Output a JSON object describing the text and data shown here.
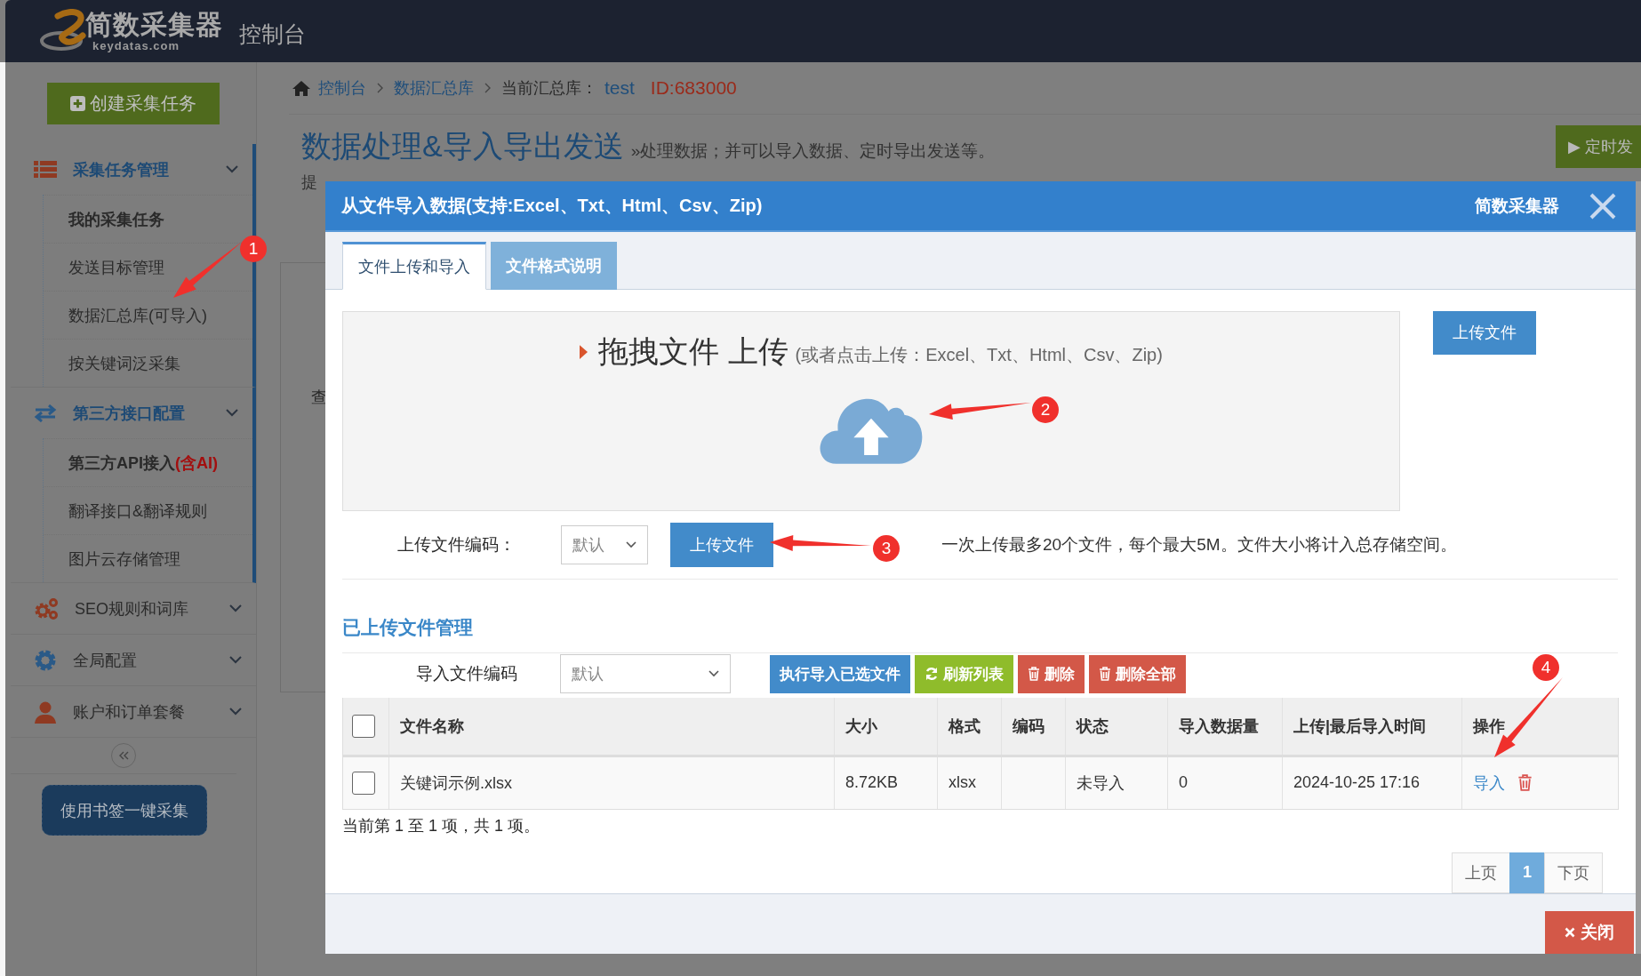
{
  "header": {
    "logo_text": "简数采集器",
    "logo_domain": "keydatas.com",
    "title": "控制台"
  },
  "sidebar": {
    "create_button": "创建采集任务",
    "groups": [
      {
        "label": "采集任务管理",
        "kind": "list",
        "expanded": true,
        "children": [
          {
            "label": "我的采集任务",
            "bold": true
          },
          {
            "label": "发送目标管理",
            "bold": false
          },
          {
            "label": "数据汇总库(可导入)",
            "bold": false
          },
          {
            "label": "按关键词泛采集",
            "bold": false
          }
        ]
      },
      {
        "label": "第三方接口配置",
        "kind": "swap",
        "expanded": true,
        "children": [
          {
            "label": "第三方API接入",
            "tag": "(含AI)",
            "bold": true
          },
          {
            "label": "翻译接口&翻译规则",
            "bold": false
          },
          {
            "label": "图片云存储管理",
            "bold": false
          }
        ]
      },
      {
        "label": "SEO规则和词库",
        "kind": "gears",
        "expanded": false
      },
      {
        "label": "全局配置",
        "kind": "gear",
        "expanded": false
      },
      {
        "label": "账户和订单套餐",
        "kind": "user",
        "expanded": false
      }
    ],
    "bookmark_button": "使用书签一键采集"
  },
  "breadcrumb": {
    "items": [
      "控制台",
      "数据汇总库"
    ],
    "current_label": "当前汇总库：",
    "current_name": "test",
    "current_id": "ID:683000"
  },
  "page": {
    "title": "数据处理&导入导出发送",
    "subtitle": "»处理数据；并可以导入数据、定时导出发送等。",
    "hint": "提",
    "side_text": "查",
    "schedule_button": "▶ 定时发"
  },
  "dialog": {
    "title": "从文件导入数据(支持:Excel、Txt、Html、Csv、Zip)",
    "brand": "简数采集器",
    "tabs": [
      {
        "label": "文件上传和导入",
        "selected": true
      },
      {
        "label": "文件格式说明",
        "selected": false
      }
    ],
    "dropzone": {
      "title": "拖拽文件 上传",
      "hint": "(或者点击上传：Excel、Txt、Html、Csv、Zip)"
    },
    "upload_button": "上传文件",
    "encoding": {
      "label": "上传文件编码：",
      "value": "默认",
      "button": "上传文件",
      "note": "一次上传最多20个文件，每个最大5M。文件大小将计入总存储空间。"
    },
    "files": {
      "title": "已上传文件管理",
      "encoding_label": "导入文件编码",
      "encoding_value": "默认",
      "actions": [
        {
          "label": "执行导入已选文件",
          "kind": "primary"
        },
        {
          "label": "刷新列表",
          "kind": "refresh"
        },
        {
          "label": "删除",
          "kind": "delete"
        },
        {
          "label": "删除全部",
          "kind": "delete"
        }
      ]
    },
    "table": {
      "select_all_checked": false,
      "columns": [
        "文件名称",
        "大小",
        "格式",
        "编码",
        "状态",
        "导入数据量",
        "上传|最后导入时间",
        "操作"
      ],
      "rows": [
        {
          "checked": false,
          "name": "关键词示例.xlsx",
          "size": "8.72KB",
          "format": "xlsx",
          "status": "未导入",
          "count": "0",
          "time": "2024-10-25 17:16",
          "action": "导入"
        }
      ]
    },
    "summary": "当前第 1 至 1 项，共 1 项。",
    "pagination": [
      {
        "label": "上页",
        "selected": false
      },
      {
        "label": "1",
        "selected": true
      },
      {
        "label": "下页",
        "selected": false
      }
    ],
    "close_button": "关闭"
  },
  "annotations": [
    {
      "label": "1"
    },
    {
      "label": "2"
    },
    {
      "label": "3"
    },
    {
      "label": "4"
    }
  ]
}
